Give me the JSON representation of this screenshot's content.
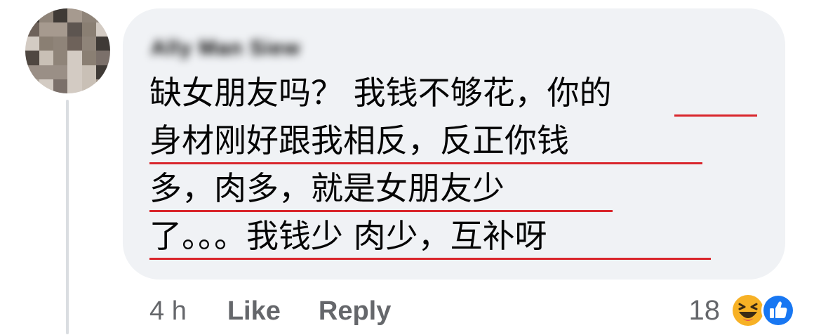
{
  "comment": {
    "author_name": "Ally Man Siew",
    "lines": [
      "缺女朋友吗？ 我钱不够花，你的",
      "身材刚好跟我相反，反正你钱",
      "多，肉多，就是女朋友少",
      "了。。。我钱少 肉少，互补呀"
    ],
    "underline_color": "#d9262c"
  },
  "actions": {
    "timestamp": "4 h",
    "like_label": "Like",
    "reply_label": "Reply"
  },
  "reactions": {
    "count": "18",
    "icons": [
      "haha-reaction-icon",
      "like-reaction-icon"
    ]
  },
  "colors": {
    "bubble": "#f0f2f5",
    "secondary_text": "#65676b",
    "like_blue": "#1877f2",
    "haha_yellow": "#f7b125"
  }
}
